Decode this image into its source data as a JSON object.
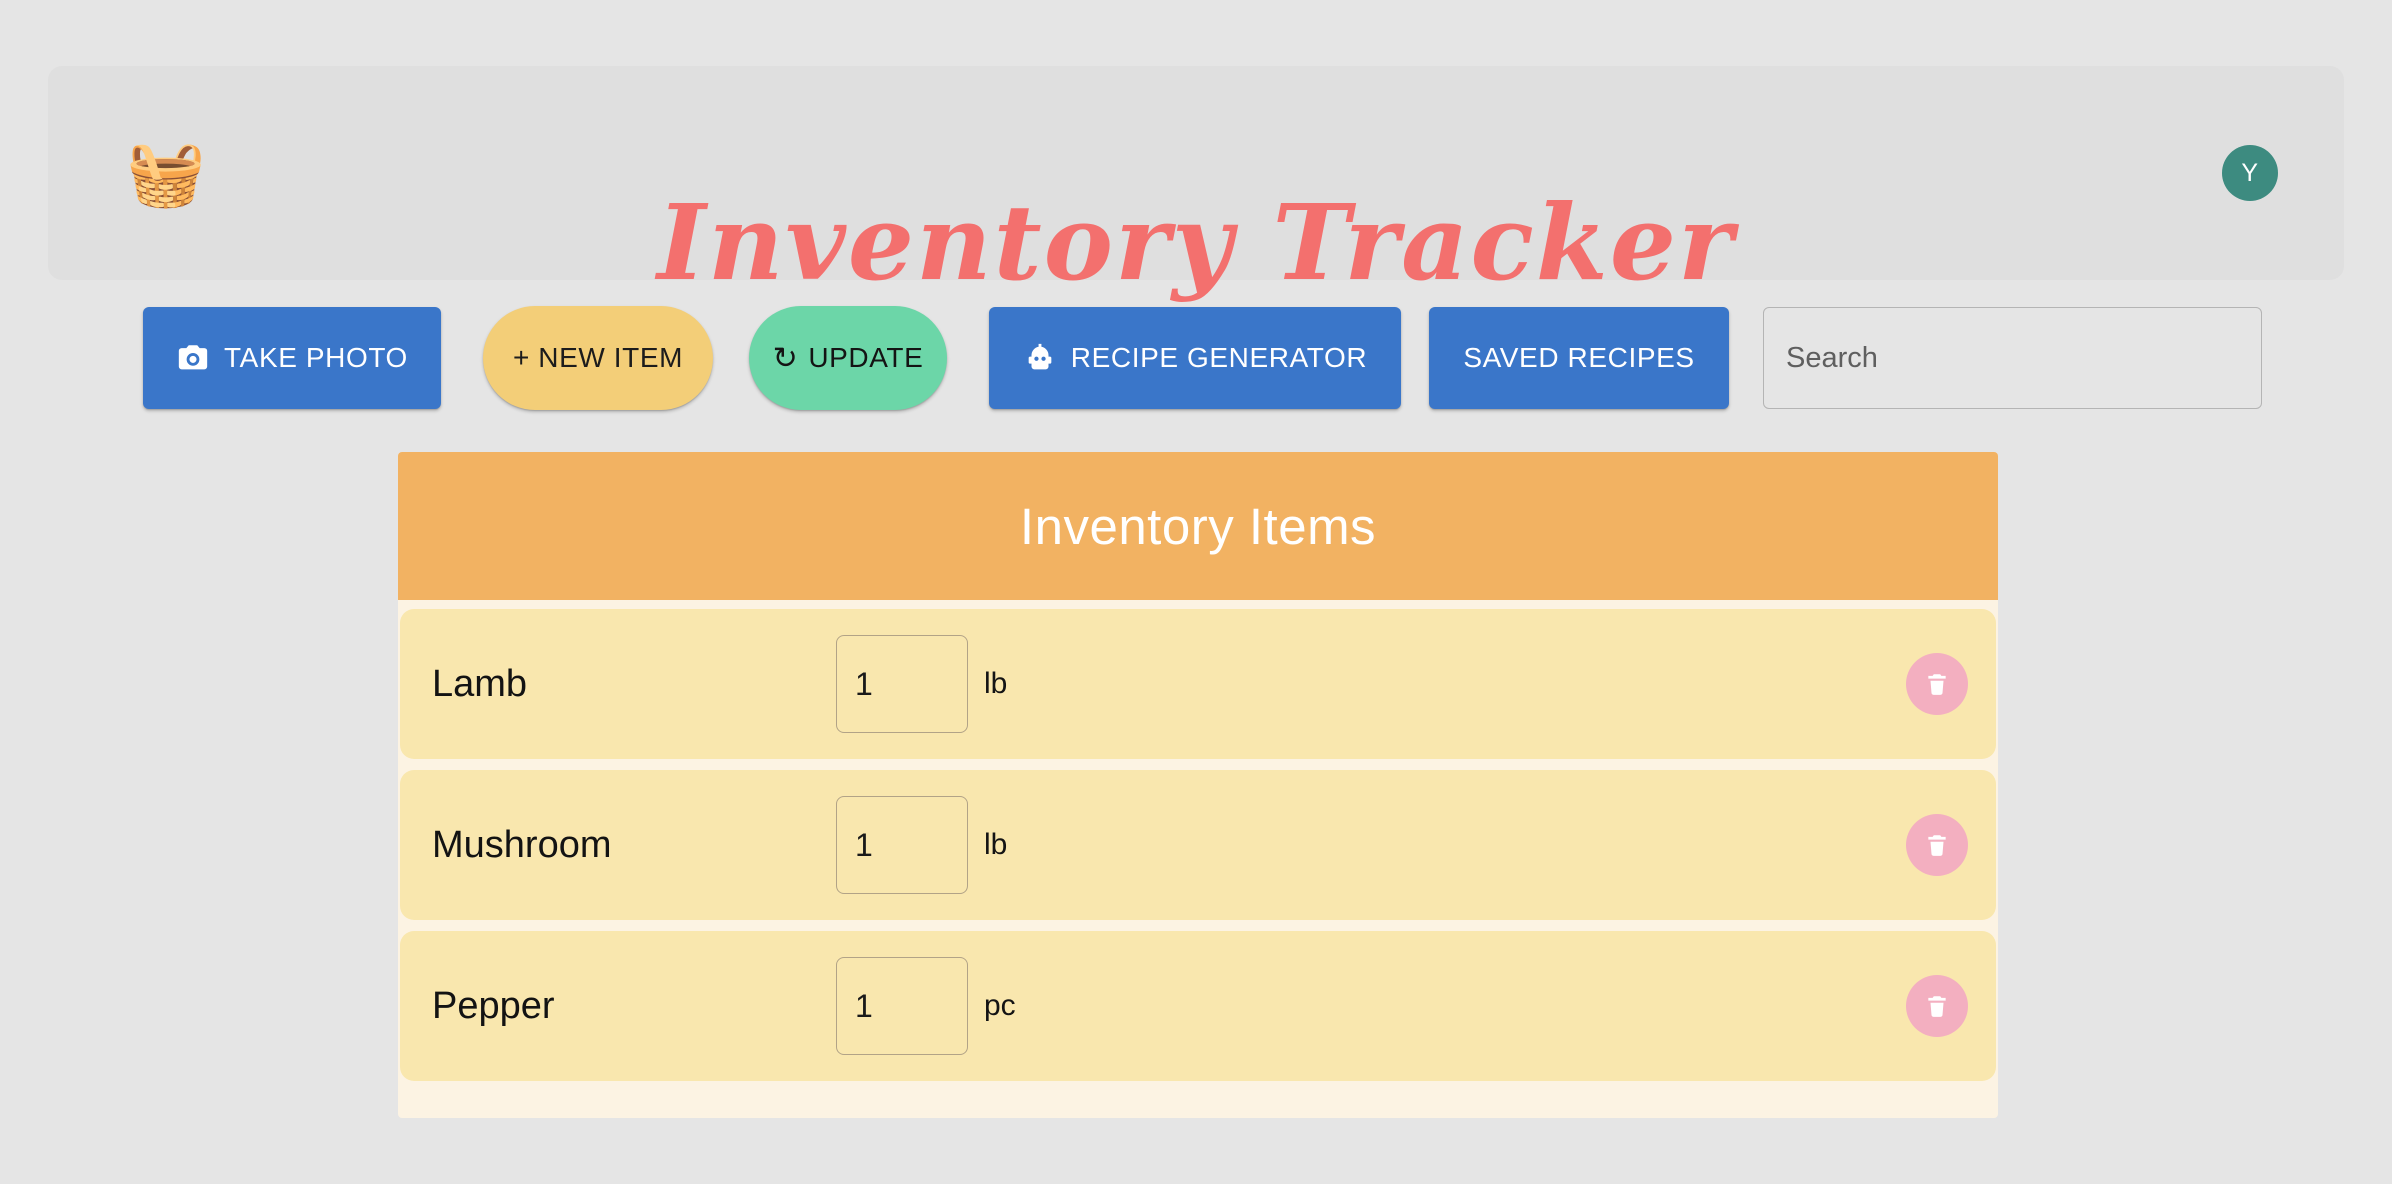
{
  "header": {
    "logo_emoji": "🧺",
    "logo_icon": "grocery-basket-icon",
    "title": "Inventory Tracker",
    "title_color": "#f3706e",
    "panel_color": "#dfdfdf",
    "avatar": {
      "initial": "Y",
      "color": "#3d8b80"
    }
  },
  "toolbar": {
    "take_photo_label": "TAKE PHOTO",
    "new_item_label": "+ NEW ITEM",
    "update_label": "UPDATE",
    "update_glyph": "↻",
    "recipe_generator_label": "RECIPE GENERATOR",
    "saved_recipes_label": "SAVED RECIPES",
    "colors": {
      "blue": "#3a76c9",
      "yellow": "#f3ce78",
      "green": "#6cd6a8"
    }
  },
  "search": {
    "value": "",
    "placeholder": "Search"
  },
  "inventory": {
    "title": "Inventory Items",
    "header_color": "#f2b262",
    "row_color": "#f9e7ae",
    "card_color": "#fcf3e3",
    "delete_color": "#f3afc0",
    "items": [
      {
        "name": "Lamb",
        "quantity": "1",
        "unit": "lb"
      },
      {
        "name": "Mushroom",
        "quantity": "1",
        "unit": "lb"
      },
      {
        "name": "Pepper",
        "quantity": "1",
        "unit": "pc"
      }
    ]
  }
}
